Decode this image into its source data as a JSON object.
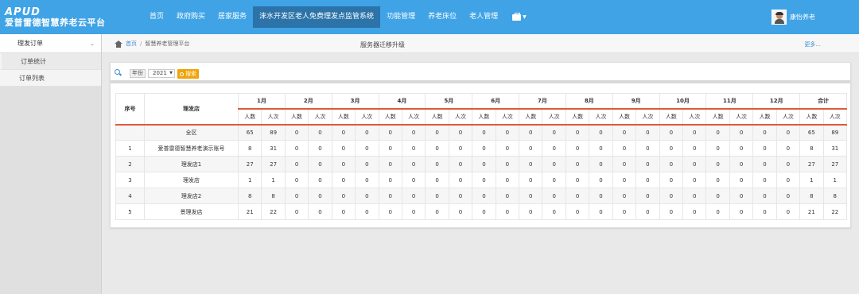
{
  "app": {
    "logo_mark": "APUD",
    "logo_name": "爱普雷德智慧养老云平台"
  },
  "nav": {
    "items": [
      "首页",
      "政府购买",
      "居家服务",
      "涞水开发区老人免费理发点监管系统",
      "功能管理",
      "养老床位",
      "老人管理"
    ],
    "user_name": "康怡养老"
  },
  "sidebar": {
    "group": "理发订单",
    "items": [
      "订单统计",
      "订单列表"
    ]
  },
  "breadcrumb": {
    "home": "首页",
    "current": "智慧养老管理平台",
    "notice": "服务器迁移升级",
    "more": "更多..."
  },
  "search": {
    "year_label": "年份",
    "year_value": "2021",
    "button": "搜索"
  },
  "table": {
    "col_index": "序号",
    "col_store": "理发店",
    "months": [
      "1月",
      "2月",
      "3月",
      "4月",
      "5月",
      "6月",
      "7月",
      "8月",
      "9月",
      "10月",
      "11月",
      "12月",
      "合计"
    ],
    "sub_a": "人数",
    "sub_b": "人次",
    "rows": [
      {
        "index": "",
        "store": "全区",
        "values": [
          65,
          89,
          0,
          0,
          0,
          0,
          0,
          0,
          0,
          0,
          0,
          0,
          0,
          0,
          0,
          0,
          0,
          0,
          0,
          0,
          0,
          0,
          0,
          0,
          65,
          89
        ]
      },
      {
        "index": "1",
        "store": "爱普雷德智慧养老演示账号",
        "values": [
          8,
          31,
          0,
          0,
          0,
          0,
          0,
          0,
          0,
          0,
          0,
          0,
          0,
          0,
          0,
          0,
          0,
          0,
          0,
          0,
          0,
          0,
          0,
          0,
          8,
          31
        ]
      },
      {
        "index": "2",
        "store": "理发店1",
        "values": [
          27,
          27,
          0,
          0,
          0,
          0,
          0,
          0,
          0,
          0,
          0,
          0,
          0,
          0,
          0,
          0,
          0,
          0,
          0,
          0,
          0,
          0,
          0,
          0,
          27,
          27
        ]
      },
      {
        "index": "3",
        "store": "理发店",
        "values": [
          1,
          1,
          0,
          0,
          0,
          0,
          0,
          0,
          0,
          0,
          0,
          0,
          0,
          0,
          0,
          0,
          0,
          0,
          0,
          0,
          0,
          0,
          0,
          0,
          1,
          1
        ]
      },
      {
        "index": "4",
        "store": "理发店2",
        "values": [
          8,
          8,
          0,
          0,
          0,
          0,
          0,
          0,
          0,
          0,
          0,
          0,
          0,
          0,
          0,
          0,
          0,
          0,
          0,
          0,
          0,
          0,
          0,
          0,
          8,
          8
        ]
      },
      {
        "index": "5",
        "store": "景理发店",
        "values": [
          21,
          22,
          0,
          0,
          0,
          0,
          0,
          0,
          0,
          0,
          0,
          0,
          0,
          0,
          0,
          0,
          0,
          0,
          0,
          0,
          0,
          0,
          0,
          0,
          21,
          22
        ]
      }
    ]
  },
  "colors": {
    "topbar": "#3fa3e6",
    "nav_active": "#2b73a8",
    "accent_orange": "#f0a30a",
    "header_rule": "#e05a3a"
  }
}
